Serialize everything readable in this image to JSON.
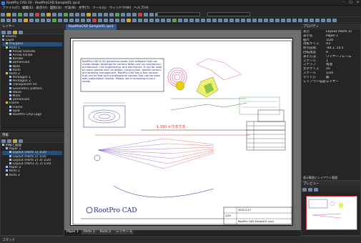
{
  "window": {
    "title": "RootPro CAD 10 - RootProCAD Sample01.rpcd"
  },
  "menu": [
    "ファイル(F)",
    "編集(E)",
    "表示(V)",
    "図形(D)",
    "寸法(N)",
    "文字(T)",
    "ツール(L)",
    "ウィンドウ(W)",
    "ヘルプ(H)"
  ],
  "doc_tab": "RootProCAD Sample01.rpcd",
  "layer_panel": {
    "title": "レイヤー",
    "items": [
      {
        "label": "Sheet1",
        "level": 0,
        "color": "#7aa0d8",
        "sel": false
      },
      {
        "label": "Layer",
        "level": 0,
        "color": "#7aa0d8",
        "sel": false
      },
      {
        "label": "Polygon1",
        "level": 1,
        "color": "#d8c060",
        "sel": true
      },
      {
        "label": "Parts 1",
        "level": 1,
        "color": "#d8c060",
        "sel": false
      },
      {
        "label": "Arrow Outside",
        "level": 2,
        "color": "#9cc0ff",
        "sel": false
      },
      {
        "label": "Arrow Inside",
        "level": 2,
        "color": "#9cc0ff",
        "sel": false
      },
      {
        "label": "Border",
        "level": 2,
        "color": "#9cc0ff",
        "sel": false
      },
      {
        "label": "Dimension",
        "level": 2,
        "color": "#9cc0ff",
        "sel": false
      },
      {
        "label": "Note",
        "level": 2,
        "color": "#9cc0ff",
        "sel": false
      },
      {
        "label": "Parts",
        "level": 2,
        "color": "#9cc0ff",
        "sel": false
      },
      {
        "label": "Parts 2",
        "level": 1,
        "color": "#d8c060",
        "sel": false
      },
      {
        "label": "Pentagon 1",
        "level": 2,
        "color": "#9cc0ff",
        "sel": false
      },
      {
        "label": "Pentagon 2",
        "level": 2,
        "color": "#9cc0ff",
        "sel": false
      },
      {
        "label": "Transparent Fill",
        "level": 2,
        "color": "#9cc0ff",
        "sel": false
      },
      {
        "label": "Geometric pattern",
        "level": 2,
        "color": "#9cc0ff",
        "sel": false
      },
      {
        "label": "Wave",
        "level": 2,
        "color": "#9cc0ff",
        "sel": false
      },
      {
        "label": "Mark",
        "level": 2,
        "color": "#9cc0ff",
        "sel": false
      },
      {
        "label": "Dimension",
        "level": 2,
        "color": "#9cc0ff",
        "sel": false
      },
      {
        "label": "Frame",
        "level": 1,
        "color": "#d8c060",
        "sel": false
      },
      {
        "label": "Frame",
        "level": 2,
        "color": "#9cc0ff",
        "sel": false
      },
      {
        "label": "Spot",
        "level": 2,
        "color": "#9cc0ff",
        "sel": false
      },
      {
        "label": "RootPro CAD Logo",
        "level": 2,
        "color": "#9cc0ff",
        "sel": false
      }
    ]
  },
  "sheet_panel": {
    "title": "用紙",
    "items": [
      {
        "label": "用紙と図面",
        "level": 0,
        "sel": false
      },
      {
        "label": "Paper 1",
        "level": 1,
        "sel": false
      },
      {
        "label": "Layout (Parts 1) 1/20",
        "level": 2,
        "sel": true
      },
      {
        "label": "Layout (Parts 2) 1/25",
        "level": 2,
        "sel": false
      },
      {
        "label": "Layout (Parts 2) 3) 1/20",
        "level": 2,
        "sel": false
      },
      {
        "label": "Layout (Part1 2) 3) 1/20",
        "level": 2,
        "sel": false
      },
      {
        "label": "Paper 2",
        "level": 1,
        "sel": false
      },
      {
        "label": "Parts 1",
        "level": 1,
        "sel": false
      },
      {
        "label": "Parts 2",
        "level": 1,
        "sel": false
      }
    ]
  },
  "props_panel": {
    "title": "プロパティ",
    "rows": [
      {
        "k": "表示",
        "v": "Layout (Parts 1)"
      },
      {
        "k": "表示名",
        "v": "Paper 1"
      },
      {
        "k": "縮尺",
        "v": "1/20"
      },
      {
        "k": "用紙サイズ",
        "v": "A3"
      },
      {
        "k": "原点座標",
        "v": "-44.1, 14.5"
      },
      {
        "k": "回転角度",
        "v": "0"
      },
      {
        "k": "表示方法",
        "v": "ワイヤーフレーム"
      },
      {
        "k": "スケール",
        "v": "1"
      },
      {
        "k": "スナップ",
        "v": "有効"
      },
      {
        "k": "文字サイズ",
        "v": "25"
      },
      {
        "k": "スケール",
        "v": "1/20"
      },
      {
        "k": "タイトル",
        "v": "無"
      },
      {
        "k": "レイアウト描画",
        "v": "レイヤー"
      }
    ],
    "section": "表示範囲とレイアウト管理"
  },
  "preview_panel": {
    "title": "プレビュー"
  },
  "sheet_note": "RootPro CAD is 2D general-purpose CAD software that can create design drawings for various fields such as mechanical, architecture, civil engineering, and electronics. It can be used by many people such as design, construction, quality control, and drawing management. RootPro CAD has a free version that can be free and a professional version that can be used with subscription license. Please use it according to your needs.",
  "dim_text": "1,310 ±寸法寸法",
  "logo_text": "RootPro CAD",
  "title_block": {
    "date": "2022.3.27",
    "name": "RootPro CAD Sample01.rpcd",
    "scale": "1/20"
  },
  "bottom_tabs": [
    "Paper 1",
    "Parts 1",
    "Parts 2",
    "レイヤー 4"
  ],
  "statusbar": "コマンド"
}
